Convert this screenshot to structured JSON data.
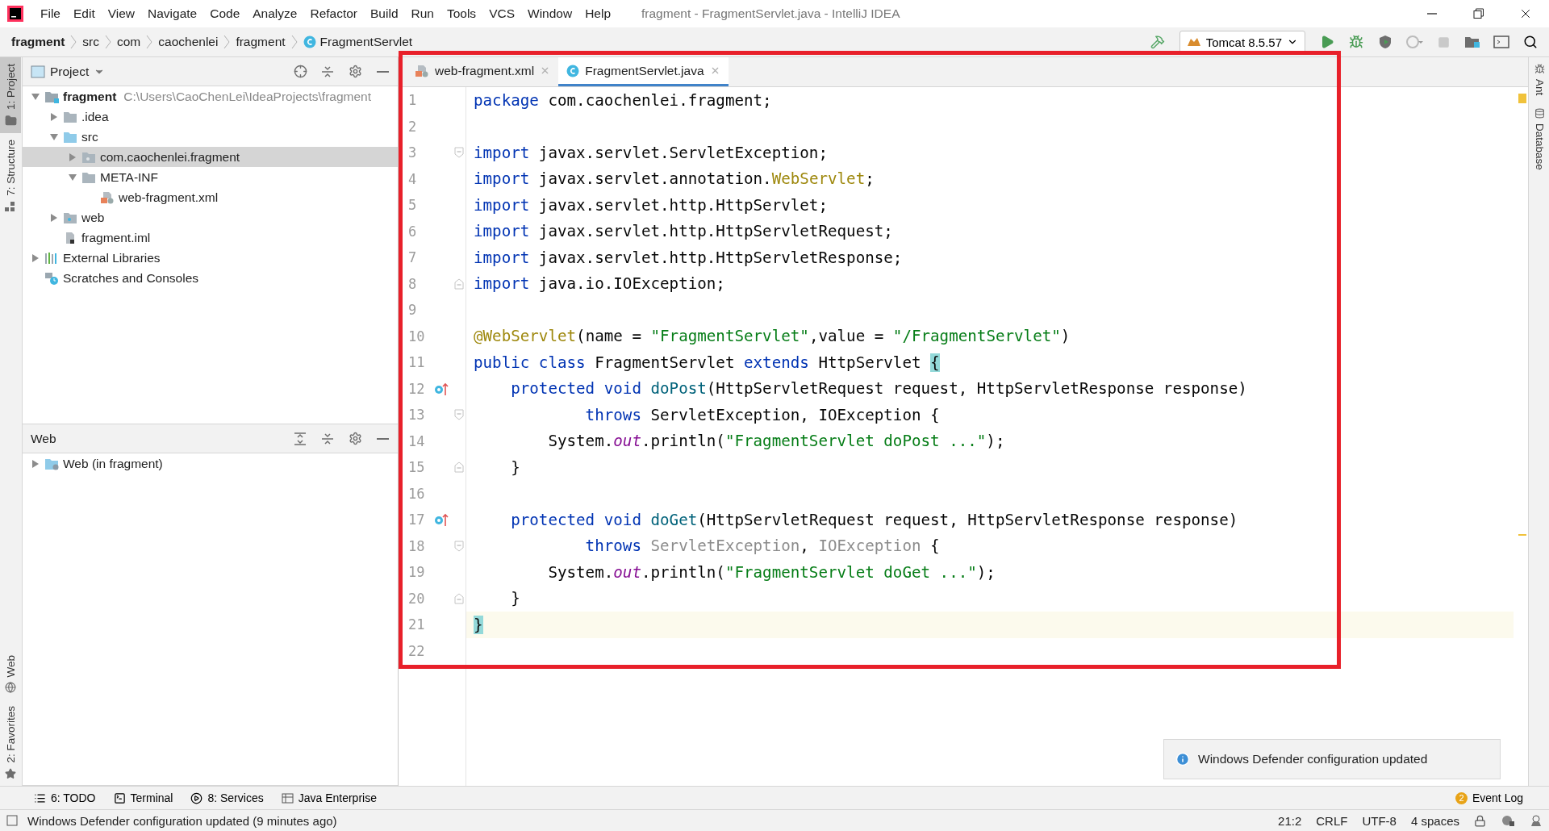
{
  "window": {
    "title": "fragment - FragmentServlet.java - IntelliJ IDEA"
  },
  "menu": [
    "File",
    "Edit",
    "View",
    "Navigate",
    "Code",
    "Analyze",
    "Refactor",
    "Build",
    "Run",
    "Tools",
    "VCS",
    "Window",
    "Help"
  ],
  "breadcrumbs": [
    {
      "label": "fragment",
      "kind": "project"
    },
    {
      "label": "src",
      "kind": "dir"
    },
    {
      "label": "com",
      "kind": "dir"
    },
    {
      "label": "caochenlei",
      "kind": "dir"
    },
    {
      "label": "fragment",
      "kind": "dir"
    },
    {
      "label": "FragmentServlet",
      "kind": "class"
    }
  ],
  "run_config": {
    "label": "Tomcat 8.5.57"
  },
  "left_stripe_top": [
    {
      "label": "1: Project",
      "kind": "project",
      "selected": true
    },
    {
      "label": "7: Structure",
      "kind": "structure",
      "selected": false
    }
  ],
  "left_stripe_bottom": [
    {
      "label": "Web",
      "kind": "web",
      "selected": false
    },
    {
      "label": "2: Favorites",
      "kind": "favorites",
      "selected": false
    }
  ],
  "project_panel": {
    "title": "Project",
    "tree": [
      {
        "label": "fragment",
        "kind": "module",
        "path": "C:\\Users\\CaoChenLei\\IdeaProjects\\fragment",
        "expanded": true,
        "selected": false,
        "children": [
          {
            "label": ".idea",
            "kind": "folder",
            "expanded": false,
            "selected": false
          },
          {
            "label": "src",
            "kind": "source",
            "expanded": true,
            "selected": false,
            "children": [
              {
                "label": "com.caochenlei.fragment",
                "kind": "package",
                "expanded": false,
                "selected": true
              },
              {
                "label": "META-INF",
                "kind": "folder",
                "expanded": true,
                "selected": false,
                "children": [
                  {
                    "label": "web-fragment.xml",
                    "kind": "xml",
                    "selected": false
                  }
                ]
              }
            ]
          },
          {
            "label": "web",
            "kind": "web",
            "expanded": false,
            "selected": false
          },
          {
            "label": "fragment.iml",
            "kind": "iml",
            "selected": false
          }
        ]
      },
      {
        "label": "External Libraries",
        "kind": "libraries",
        "expanded": false,
        "selected": false
      },
      {
        "label": "Scratches and Consoles",
        "kind": "scratches",
        "selected": false
      }
    ]
  },
  "web_panel": {
    "title": "Web",
    "tree": [
      {
        "label": "Web (in fragment)",
        "kind": "facet",
        "expanded": false,
        "selected": false
      }
    ]
  },
  "editor": {
    "tabs": [
      {
        "label": "web-fragment.xml",
        "kind": "xml",
        "selected": false
      },
      {
        "label": "FragmentServlet.java",
        "kind": "class",
        "selected": true
      }
    ],
    "lines": [
      {
        "number": "1",
        "current": false,
        "override": false,
        "fold_open": false,
        "fold_close": false,
        "tokens": [
          {
            "kind": "keyword",
            "text": "package"
          },
          {
            "kind": "plain",
            "text": " com.caochenlei.fragment;"
          }
        ]
      },
      {
        "number": "2",
        "current": false,
        "override": false,
        "fold_open": false,
        "fold_close": false
      },
      {
        "number": "3",
        "current": false,
        "override": false,
        "fold_open": true,
        "fold_close": false,
        "tokens": [
          {
            "kind": "keyword",
            "text": "import"
          },
          {
            "kind": "plain",
            "text": " javax.servlet.ServletException;"
          }
        ]
      },
      {
        "number": "4",
        "current": false,
        "override": false,
        "fold_open": false,
        "fold_close": false,
        "tokens": [
          {
            "kind": "keyword",
            "text": "import"
          },
          {
            "kind": "plain",
            "text": " javax.servlet.annotation."
          },
          {
            "kind": "annotation",
            "text": "WebServlet"
          },
          {
            "kind": "plain",
            "text": ";"
          }
        ]
      },
      {
        "number": "5",
        "current": false,
        "override": false,
        "fold_open": false,
        "fold_close": false,
        "tokens": [
          {
            "kind": "keyword",
            "text": "import"
          },
          {
            "kind": "plain",
            "text": " javax.servlet.http.HttpServlet;"
          }
        ]
      },
      {
        "number": "6",
        "current": false,
        "override": false,
        "fold_open": false,
        "fold_close": false,
        "tokens": [
          {
            "kind": "keyword",
            "text": "import"
          },
          {
            "kind": "plain",
            "text": " javax.servlet.http.HttpServletRequest;"
          }
        ]
      },
      {
        "number": "7",
        "current": false,
        "override": false,
        "fold_open": false,
        "fold_close": false,
        "tokens": [
          {
            "kind": "keyword",
            "text": "import"
          },
          {
            "kind": "plain",
            "text": " javax.servlet.http.HttpServletResponse;"
          }
        ]
      },
      {
        "number": "8",
        "current": false,
        "override": false,
        "fold_open": false,
        "fold_close": true,
        "tokens": [
          {
            "kind": "keyword",
            "text": "import"
          },
          {
            "kind": "plain",
            "text": " java.io.IOException;"
          }
        ]
      },
      {
        "number": "9",
        "current": false,
        "override": false,
        "fold_open": false,
        "fold_close": false
      },
      {
        "number": "10",
        "current": false,
        "override": false,
        "fold_open": false,
        "fold_close": false,
        "tokens": [
          {
            "kind": "annotation",
            "text": "@WebServlet"
          },
          {
            "kind": "plain",
            "text": "(name = "
          },
          {
            "kind": "string",
            "text": "\"FragmentServlet\""
          },
          {
            "kind": "plain",
            "text": ",value = "
          },
          {
            "kind": "string",
            "text": "\"/FragmentServlet\""
          },
          {
            "kind": "plain",
            "text": ")"
          }
        ]
      },
      {
        "number": "11",
        "current": false,
        "override": false,
        "fold_open": false,
        "fold_close": false,
        "tokens": [
          {
            "kind": "keyword",
            "text": "public class"
          },
          {
            "kind": "plain",
            "text": " FragmentServlet "
          },
          {
            "kind": "keyword",
            "text": "extends"
          },
          {
            "kind": "plain",
            "text": " HttpServlet "
          },
          {
            "kind": "brace",
            "text": "{"
          }
        ]
      },
      {
        "number": "12",
        "current": false,
        "override": true,
        "fold_open": false,
        "fold_close": false,
        "tokens": [
          {
            "kind": "keyword",
            "text": "    protected void "
          },
          {
            "kind": "method",
            "text": "doPost"
          },
          {
            "kind": "plain",
            "text": "(HttpServletRequest request, HttpServletResponse response)"
          }
        ]
      },
      {
        "number": "13",
        "current": false,
        "override": false,
        "fold_open": true,
        "fold_close": false,
        "tokens": [
          {
            "kind": "keyword",
            "text": "            throws"
          },
          {
            "kind": "plain",
            "text": " ServletException, IOException {"
          }
        ]
      },
      {
        "number": "14",
        "current": false,
        "override": false,
        "fold_open": false,
        "fold_close": false,
        "tokens": [
          {
            "kind": "plain",
            "text": "        System."
          },
          {
            "kind": "field",
            "text": "out"
          },
          {
            "kind": "plain",
            "text": ".println("
          },
          {
            "kind": "string",
            "text": "\"FragmentServlet doPost ...\""
          },
          {
            "kind": "plain",
            "text": ");"
          }
        ]
      },
      {
        "number": "15",
        "current": false,
        "override": false,
        "fold_open": false,
        "fold_close": true,
        "tokens": [
          {
            "kind": "plain",
            "text": "    }"
          }
        ]
      },
      {
        "number": "16",
        "current": false,
        "override": false,
        "fold_open": false,
        "fold_close": false
      },
      {
        "number": "17",
        "current": false,
        "override": true,
        "fold_open": false,
        "fold_close": false,
        "tokens": [
          {
            "kind": "keyword",
            "text": "    protected void "
          },
          {
            "kind": "method",
            "text": "doGet"
          },
          {
            "kind": "plain",
            "text": "(HttpServletRequest request, HttpServletResponse response)"
          }
        ]
      },
      {
        "number": "18",
        "current": false,
        "override": false,
        "fold_open": true,
        "fold_close": false,
        "tokens": [
          {
            "kind": "keyword",
            "text": "            throws "
          },
          {
            "kind": "muted",
            "text": "ServletException"
          },
          {
            "kind": "plain",
            "text": ", "
          },
          {
            "kind": "muted",
            "text": "IOException"
          },
          {
            "kind": "plain",
            "text": " {"
          }
        ]
      },
      {
        "number": "19",
        "current": false,
        "override": false,
        "fold_open": false,
        "fold_close": false,
        "tokens": [
          {
            "kind": "plain",
            "text": "        System."
          },
          {
            "kind": "field",
            "text": "out"
          },
          {
            "kind": "plain",
            "text": ".println("
          },
          {
            "kind": "string",
            "text": "\"FragmentServlet doGet ...\""
          },
          {
            "kind": "plain",
            "text": ");"
          }
        ]
      },
      {
        "number": "20",
        "current": false,
        "override": false,
        "fold_open": false,
        "fold_close": true,
        "tokens": [
          {
            "kind": "plain",
            "text": "    }"
          }
        ]
      },
      {
        "number": "21",
        "current": true,
        "override": false,
        "fold_open": false,
        "fold_close": false,
        "tokens": [
          {
            "kind": "brace",
            "text": "}"
          }
        ]
      },
      {
        "number": "22",
        "current": false,
        "override": false,
        "fold_open": false,
        "fold_close": false
      }
    ]
  },
  "right_stripe": [
    "Ant",
    "Database"
  ],
  "notification": {
    "text": "Windows Defender configuration updated"
  },
  "tool_windows": [
    {
      "label": "6: TODO",
      "kind": "todo"
    },
    {
      "label": "Terminal",
      "kind": "terminal"
    },
    {
      "label": "8: Services",
      "kind": "services"
    },
    {
      "label": "Java Enterprise",
      "kind": "enterprise"
    }
  ],
  "event_log": {
    "label": "Event Log",
    "count": "2"
  },
  "status_bar": {
    "message": "Windows Defender configuration updated (9 minutes ago)",
    "items": [
      "21:2",
      "CRLF",
      "UTF-8",
      "4 spaces"
    ]
  }
}
